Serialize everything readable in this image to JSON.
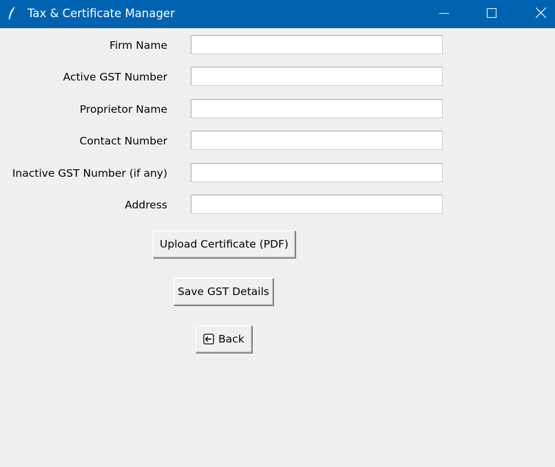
{
  "window": {
    "title": "Tax & Certificate Manager",
    "app_icon": "feather-icon",
    "controls": [
      "minimize-icon",
      "maximize-icon",
      "close-icon"
    ]
  },
  "form": {
    "fields": [
      {
        "label": "Firm Name",
        "value": "",
        "placeholder": ""
      },
      {
        "label": "Active GST Number",
        "value": "",
        "placeholder": ""
      },
      {
        "label": "Proprietor Name",
        "value": "",
        "placeholder": ""
      },
      {
        "label": "Contact Number",
        "value": "",
        "placeholder": ""
      },
      {
        "label": "Inactive GST Number (if any)",
        "value": "",
        "placeholder": ""
      },
      {
        "label": "Address",
        "value": "",
        "placeholder": ""
      }
    ]
  },
  "buttons": {
    "upload_label": "Upload Certificate (PDF)",
    "save_label": "Save GST Details",
    "back_label": "Back",
    "back_icon": "back-arrow-icon"
  },
  "colors": {
    "titlebar": "#0063b1",
    "background": "#f0f0f0",
    "input_bg": "#ffffff"
  }
}
